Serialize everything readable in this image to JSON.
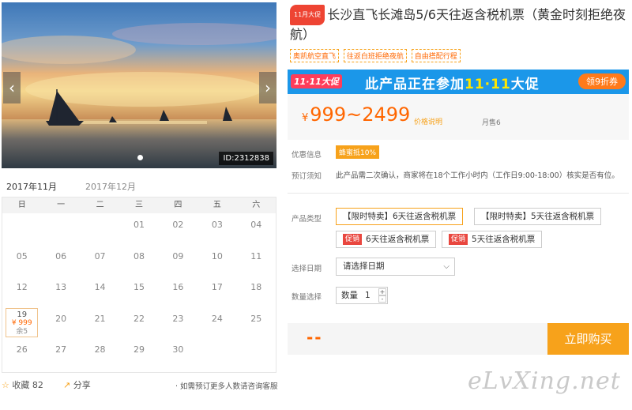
{
  "hero": {
    "image_id": "ID:2312838",
    "prev_arrow": "‹",
    "next_arrow": "›"
  },
  "calendar": {
    "tabs": [
      "2017年11月",
      "2017年12月"
    ],
    "weekdays": [
      "日",
      "一",
      "二",
      "三",
      "四",
      "五",
      "六"
    ],
    "rows": [
      [
        "",
        "",
        "",
        "01",
        "02",
        "03",
        "04"
      ],
      [
        "05",
        "06",
        "07",
        "08",
        "09",
        "10",
        "11"
      ],
      [
        "12",
        "13",
        "14",
        "15",
        "16",
        "17",
        "18"
      ],
      [
        "19",
        "20",
        "21",
        "22",
        "23",
        "24",
        "25"
      ],
      [
        "26",
        "27",
        "28",
        "29",
        "30",
        "",
        ""
      ]
    ],
    "available_day": {
      "day": "19",
      "price": "¥ 999",
      "stock": "余5"
    }
  },
  "footer": {
    "fav_icon": "☆",
    "fav_label": "收藏",
    "fav_count": "82",
    "share_icon": "↗",
    "share_label": "分享",
    "consult": "· 如需预订更多人数请咨询客服"
  },
  "product": {
    "badge": "11月大促",
    "title": "长沙直飞长滩岛5/6天往返含税机票（黄金时刻拒绝夜航）",
    "tags": [
      "奥凯航空直飞",
      "往返白班拒绝夜航",
      "自由搭配行程"
    ]
  },
  "promo": {
    "logo": "11·11大促",
    "text_prefix": "此产品正在参加",
    "text_highlight": "11·11",
    "text_suffix": "大促",
    "coupon": "领9折券"
  },
  "price": {
    "currency": "¥",
    "range": "999~2499",
    "note": "价格说明",
    "sold": "月售6"
  },
  "info": {
    "discount_label": "优惠信息",
    "discount_value": "蜂蜜抵10%",
    "notice_label": "预订须知",
    "notice_text": "此产品需二次确认，商家将在18个工作小时内（工作日9:00-18:00）核实是否有位。"
  },
  "options": {
    "type_label": "产品类型",
    "types": [
      "【限时特卖】6天往返含税机票",
      "【限时特卖】5天往返含税机票",
      "6天往返含税机票",
      "5天往返含税机票"
    ],
    "sale_tag": "促销",
    "date_label": "选择日期",
    "date_placeholder": "请选择日期",
    "qty_label": "数量选择",
    "qty_prefix": "数量",
    "qty_value": "1"
  },
  "buy": {
    "total": "--",
    "button": "立即购买"
  },
  "watermark": "eLvXing.net"
}
